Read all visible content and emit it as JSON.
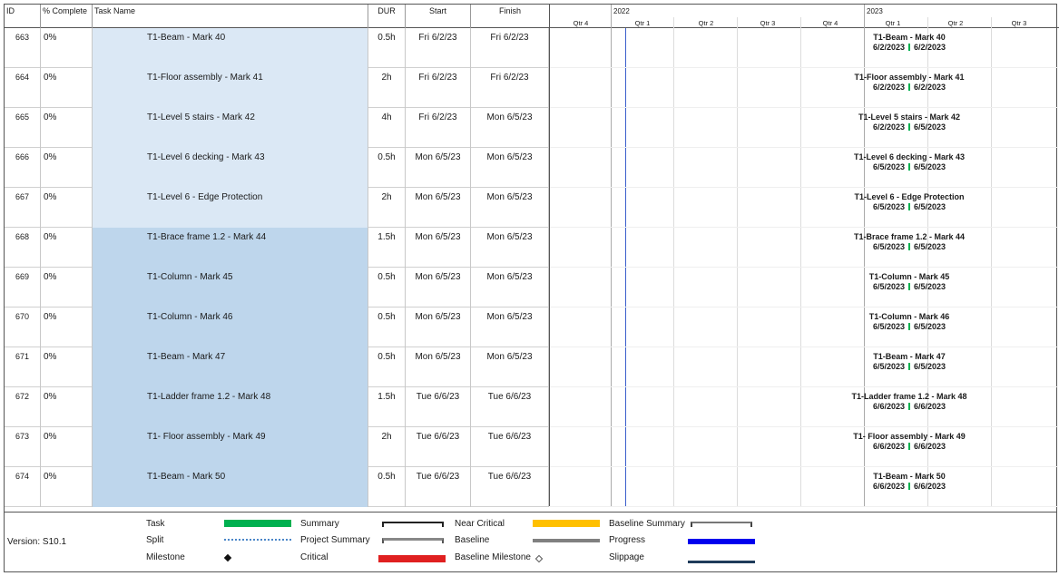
{
  "columns": {
    "id": "ID",
    "pct": "% Complete",
    "name": "Task Name",
    "dur": "DUR",
    "start": "Start",
    "finish": "Finish"
  },
  "timescale": {
    "years": [
      "2022",
      "2023"
    ],
    "quarters": [
      "Qtr 4",
      "Qtr 1",
      "Qtr 2",
      "Qtr 3",
      "Qtr 4",
      "Qtr 1",
      "Qtr 2",
      "Qtr 3"
    ]
  },
  "tasks": [
    {
      "id": "663",
      "pct": "0%",
      "name": "T1-Beam - Mark 40",
      "dur": "0.5h",
      "start": "Fri 6/2/23",
      "finish": "Fri 6/2/23",
      "bar_label": "T1-Beam - Mark 40",
      "bar_start": "6/2/2023",
      "bar_finish": "6/2/2023"
    },
    {
      "id": "664",
      "pct": "0%",
      "name": "T1-Floor assembly - Mark 41",
      "dur": "2h",
      "start": "Fri 6/2/23",
      "finish": "Fri 6/2/23",
      "bar_label": "T1-Floor assembly - Mark 41",
      "bar_start": "6/2/2023",
      "bar_finish": "6/2/2023"
    },
    {
      "id": "665",
      "pct": "0%",
      "name": "T1-Level 5 stairs - Mark 42",
      "dur": "4h",
      "start": "Fri 6/2/23",
      "finish": "Mon 6/5/23",
      "bar_label": "T1-Level 5 stairs - Mark 42",
      "bar_start": "6/2/2023",
      "bar_finish": "6/5/2023"
    },
    {
      "id": "666",
      "pct": "0%",
      "name": "T1-Level 6 decking - Mark 43",
      "dur": "0.5h",
      "start": "Mon 6/5/23",
      "finish": "Mon 6/5/23",
      "bar_label": "T1-Level 6 decking - Mark 43",
      "bar_start": "6/5/2023",
      "bar_finish": "6/5/2023"
    },
    {
      "id": "667",
      "pct": "0%",
      "name": "T1-Level 6 - Edge Protection",
      "dur": "2h",
      "start": "Mon 6/5/23",
      "finish": "Mon 6/5/23",
      "bar_label": "T1-Level 6 - Edge Protection",
      "bar_start": "6/5/2023",
      "bar_finish": "6/5/2023"
    },
    {
      "id": "668",
      "pct": "0%",
      "name": "T1-Brace frame 1.2 - Mark 44",
      "dur": "1.5h",
      "start": "Mon 6/5/23",
      "finish": "Mon 6/5/23",
      "bar_label": "T1-Brace frame 1.2 - Mark 44",
      "bar_start": "6/5/2023",
      "bar_finish": "6/5/2023"
    },
    {
      "id": "669",
      "pct": "0%",
      "name": "T1-Column - Mark 45",
      "dur": "0.5h",
      "start": "Mon 6/5/23",
      "finish": "Mon 6/5/23",
      "bar_label": "T1-Column - Mark 45",
      "bar_start": "6/5/2023",
      "bar_finish": "6/5/2023"
    },
    {
      "id": "670",
      "pct": "0%",
      "name": "T1-Column - Mark 46",
      "dur": "0.5h",
      "start": "Mon 6/5/23",
      "finish": "Mon 6/5/23",
      "bar_label": "T1-Column - Mark 46",
      "bar_start": "6/5/2023",
      "bar_finish": "6/5/2023"
    },
    {
      "id": "671",
      "pct": "0%",
      "name": "T1-Beam - Mark 47",
      "dur": "0.5h",
      "start": "Mon 6/5/23",
      "finish": "Mon 6/5/23",
      "bar_label": "T1-Beam - Mark 47",
      "bar_start": "6/5/2023",
      "bar_finish": "6/5/2023"
    },
    {
      "id": "672",
      "pct": "0%",
      "name": "T1-Ladder frame 1.2 - Mark 48",
      "dur": "1.5h",
      "start": "Tue 6/6/23",
      "finish": "Tue 6/6/23",
      "bar_label": "T1-Ladder frame 1.2 - Mark 48",
      "bar_start": "6/6/2023",
      "bar_finish": "6/6/2023"
    },
    {
      "id": "673",
      "pct": "0%",
      "name": "T1- Floor assembly - Mark 49",
      "dur": "2h",
      "start": "Tue 6/6/23",
      "finish": "Tue 6/6/23",
      "bar_label": "T1- Floor assembly - Mark 49",
      "bar_start": "6/6/2023",
      "bar_finish": "6/6/2023"
    },
    {
      "id": "674",
      "pct": "0%",
      "name": "T1-Beam - Mark 50",
      "dur": "0.5h",
      "start": "Tue 6/6/23",
      "finish": "Tue 6/6/23",
      "bar_label": "T1-Beam - Mark 50",
      "bar_start": "6/6/2023",
      "bar_finish": "6/6/2023"
    }
  ],
  "legend": {
    "version": "Version: S10.1",
    "items": {
      "task": "Task",
      "split": "Split",
      "milestone": "Milestone",
      "summary": "Summary",
      "project_summary": "Project Summary",
      "critical": "Critical",
      "near_critical": "Near Critical",
      "baseline": "Baseline",
      "baseline_milestone": "Baseline Milestone",
      "baseline_summary": "Baseline Summary",
      "progress": "Progress",
      "slippage": "Slippage"
    },
    "colors": {
      "task": "#00b050",
      "critical": "#e02020",
      "near_critical": "#ffc000",
      "baseline": "#808080",
      "progress": "#0000ee",
      "slippage": "#1f3b5a",
      "today_line": "#3b5fcc"
    }
  }
}
